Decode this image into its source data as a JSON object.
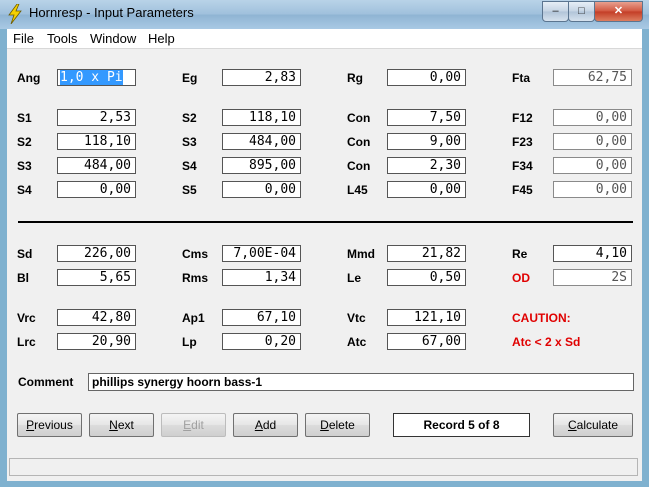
{
  "window": {
    "title": "Hornresp - Input Parameters"
  },
  "caption_buttons": {
    "minimize": "–",
    "maximize": "□",
    "close": "✕"
  },
  "menu": [
    "File",
    "Tools",
    "Window",
    "Help"
  ],
  "rows": [
    [
      {
        "label": "Ang",
        "value": "1,0 x Pi",
        "selected": true
      },
      {
        "label": "Eg",
        "value": "2,83"
      },
      {
        "label": "Rg",
        "value": "0,00"
      },
      {
        "label": "Fta",
        "value": "62,75",
        "readonly": true
      }
    ],
    [
      {
        "label": "S1",
        "value": "2,53"
      },
      {
        "label": "S2",
        "value": "118,10"
      },
      {
        "label": "Con",
        "value": "7,50"
      },
      {
        "label": "F12",
        "value": "0,00",
        "readonly": true
      }
    ],
    [
      {
        "label": "S2",
        "value": "118,10"
      },
      {
        "label": "S3",
        "value": "484,00"
      },
      {
        "label": "Con",
        "value": "9,00"
      },
      {
        "label": "F23",
        "value": "0,00",
        "readonly": true
      }
    ],
    [
      {
        "label": "S3",
        "value": "484,00"
      },
      {
        "label": "S4",
        "value": "895,00"
      },
      {
        "label": "Con",
        "value": "2,30"
      },
      {
        "label": "F34",
        "value": "0,00",
        "readonly": true
      }
    ],
    [
      {
        "label": "S4",
        "value": "0,00"
      },
      {
        "label": "S5",
        "value": "0,00"
      },
      {
        "label": "L45",
        "value": "0,00"
      },
      {
        "label": "F45",
        "value": "0,00",
        "readonly": true
      }
    ],
    [
      {
        "label": "Sd",
        "value": "226,00"
      },
      {
        "label": "Cms",
        "value": "7,00E-04"
      },
      {
        "label": "Mmd",
        "value": "21,82"
      },
      {
        "label": "Re",
        "value": "4,10"
      }
    ],
    [
      {
        "label": "Bl",
        "value": "5,65"
      },
      {
        "label": "Rms",
        "value": "1,34"
      },
      {
        "label": "Le",
        "value": "0,50"
      },
      {
        "label": "OD",
        "value": "2S",
        "readonly": true,
        "red": true
      }
    ],
    [
      {
        "label": "Vrc",
        "value": "42,80"
      },
      {
        "label": "Ap1",
        "value": "67,10"
      },
      {
        "label": "Vtc",
        "value": "121,10"
      },
      {
        "label": "CAUTION:",
        "red": true,
        "text_only": true
      }
    ],
    [
      {
        "label": "Lrc",
        "value": "20,90"
      },
      {
        "label": "Lp",
        "value": "0,20"
      },
      {
        "label": "Atc",
        "value": "67,00"
      },
      {
        "label": "Atc < 2 x Sd",
        "red": true,
        "text_only": true
      }
    ]
  ],
  "comment": {
    "label": "Comment",
    "value": "phillips synergy hoorn bass-1"
  },
  "buttons": [
    {
      "label": "Previous",
      "underline": "P",
      "enabled": true
    },
    {
      "label": "Next",
      "underline": "N",
      "enabled": true
    },
    {
      "label": "Edit",
      "underline": "E",
      "enabled": false
    },
    {
      "label": "Add",
      "underline": "A",
      "enabled": true
    },
    {
      "label": "Delete",
      "underline": "D",
      "enabled": true
    }
  ],
  "record_label": "Record 5 of 8",
  "calculate_button": {
    "label": "Calculate",
    "underline": "C",
    "enabled": true
  }
}
